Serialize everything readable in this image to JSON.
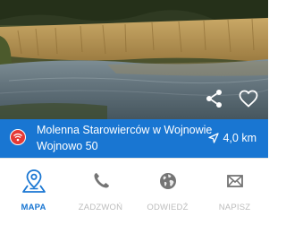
{
  "photo": {
    "share_icon": "share-icon",
    "favorite_icon": "heart-outline-icon"
  },
  "place": {
    "name": "Molenna Starowierców w Wojnowie",
    "address": "Wojnowo 50",
    "distance": "4,0 km",
    "category_icon": "wifi-badge-icon",
    "distance_icon": "navigation-arrow-icon"
  },
  "tabs": [
    {
      "label": "MAPA",
      "icon": "map-pin-icon",
      "active": true
    },
    {
      "label": "ZADZWOŃ",
      "icon": "phone-icon",
      "active": false
    },
    {
      "label": "ODWIEDŹ",
      "icon": "globe-icon",
      "active": false
    },
    {
      "label": "NAPISZ",
      "icon": "envelope-icon",
      "active": false
    }
  ],
  "colors": {
    "accent": "#1976d2",
    "inactive": "#bdbdbd",
    "badge": "#e53935"
  }
}
